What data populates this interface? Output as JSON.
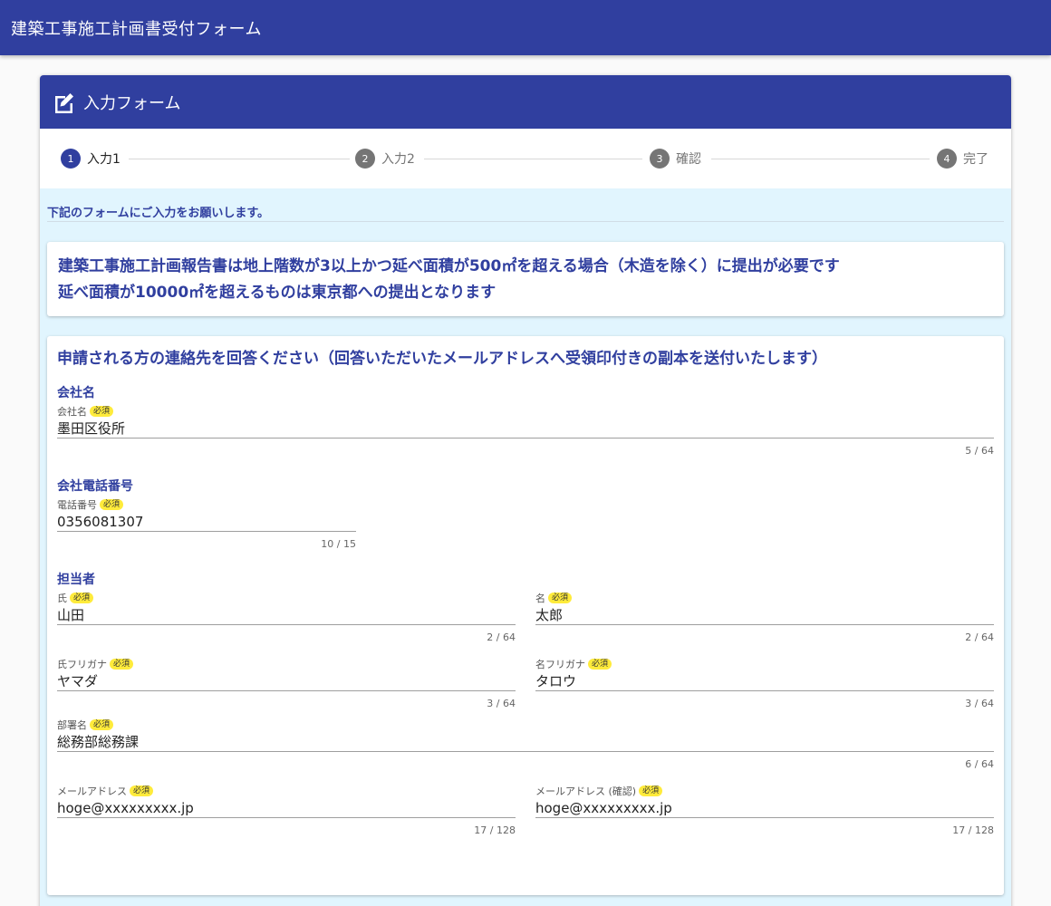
{
  "app": {
    "title": "建築工事施工計画書受付フォーム"
  },
  "card": {
    "title": "入力フォーム"
  },
  "stepper": {
    "steps": [
      {
        "number": "1",
        "label": "入力1"
      },
      {
        "number": "2",
        "label": "入力2"
      },
      {
        "number": "3",
        "label": "確認"
      },
      {
        "number": "4",
        "label": "完了"
      }
    ]
  },
  "intro": "下記のフォームにご入力をお願いします。",
  "notice": {
    "line1": "建築工事施工計画報告書は地上階数が3以上かつ延べ面積が500㎡を超える場合（木造を除く）に提出が必要です",
    "line2": "延べ面積が10000㎡を超えるものは東京都への提出となります"
  },
  "form": {
    "heading": "申請される方の連絡先を回答ください（回答いただいたメールアドレスへ受領印付きの副本を送付いたします）",
    "required": "必須",
    "company": {
      "section": "会社名",
      "label": "会社名",
      "value": "墨田区役所",
      "counter": "5 / 64"
    },
    "phone": {
      "section": "会社電話番号",
      "label": "電話番号",
      "value": "0356081307",
      "counter": "10 / 15"
    },
    "person": {
      "section": "担当者",
      "last_name": {
        "label": "氏",
        "value": "山田",
        "counter": "2 / 64"
      },
      "first_name": {
        "label": "名",
        "value": "太郎",
        "counter": "2 / 64"
      },
      "last_kana": {
        "label": "氏フリガナ",
        "value": "ヤマダ",
        "counter": "3 / 64"
      },
      "first_kana": {
        "label": "名フリガナ",
        "value": "タロウ",
        "counter": "3 / 64"
      },
      "department": {
        "label": "部署名",
        "value": "総務部総務課",
        "counter": "6 / 64"
      },
      "email": {
        "label": "メールアドレス",
        "value": "hoge@xxxxxxxxx.jp",
        "counter": "17 / 128"
      },
      "email_confirm": {
        "label": "メールアドレス (確認)",
        "value": "hoge@xxxxxxxxx.jp",
        "counter": "17 / 128"
      }
    }
  },
  "colors": {
    "primary": "#303f9f",
    "background": "#e1f5fe",
    "badge": "#ffeb3b",
    "step_inactive": "#757575"
  }
}
